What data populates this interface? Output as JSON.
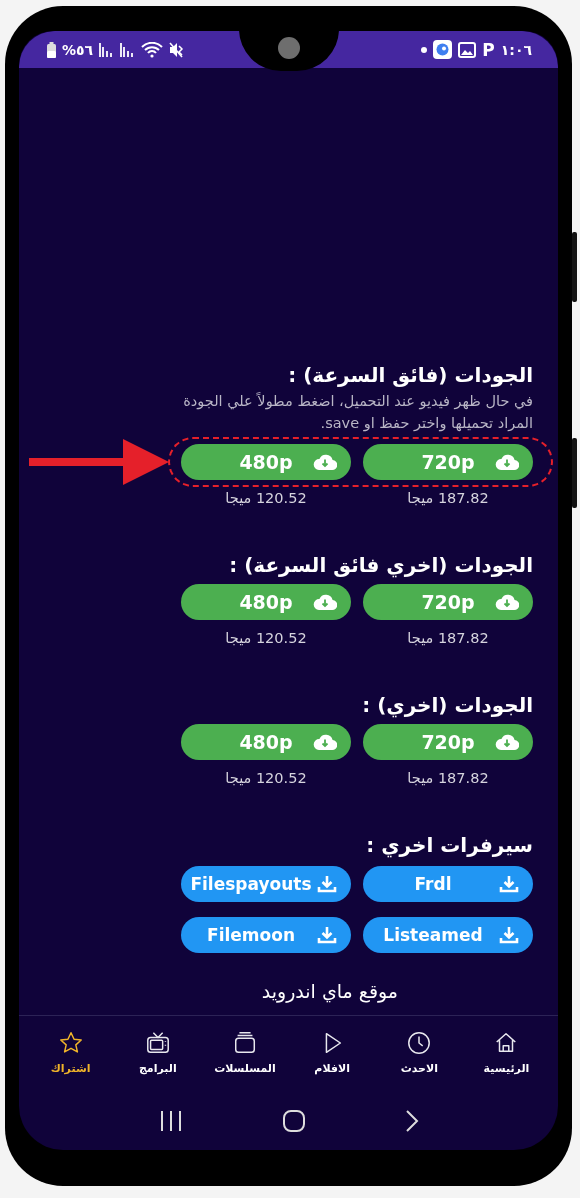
{
  "status_bar": {
    "battery": "%٥٦",
    "app_badge": "P",
    "time": "١:٠٦"
  },
  "sections": [
    {
      "title": "الجودات (فائق السرعة) :",
      "note": "في حال ظهر فيديو عند التحميل، اضغط مطولاً علي الجودة المراد تحميلها واختر حفظ او save.",
      "highlighted": true,
      "buttons": [
        {
          "label": "720p",
          "size": "187.82 ميجا"
        },
        {
          "label": "480p",
          "size": "120.52 ميجا"
        }
      ]
    },
    {
      "title": "الجودات (اخري فائق السرعة) :",
      "highlighted": false,
      "buttons": [
        {
          "label": "720p",
          "size": "187.82 ميجا"
        },
        {
          "label": "480p",
          "size": "120.52 ميجا"
        }
      ]
    },
    {
      "title": "الجودات (اخري) :",
      "highlighted": false,
      "buttons": [
        {
          "label": "720p",
          "size": "187.82 ميجا"
        },
        {
          "label": "480p",
          "size": "120.52 ميجا"
        }
      ]
    }
  ],
  "servers": {
    "title": "سيرفرات اخري :",
    "buttons": [
      "Frdl",
      "Filespayouts",
      "Listeamed",
      "Filemoon"
    ]
  },
  "footer_text": "موقع ماي اندرويد",
  "bottom_nav": [
    {
      "kind": "home",
      "label": "الرئيسية",
      "selected": false
    },
    {
      "kind": "clock",
      "label": "الاحدث",
      "selected": false
    },
    {
      "kind": "play",
      "label": "الافلام",
      "selected": false
    },
    {
      "kind": "stack",
      "label": "المسلسلات",
      "selected": false
    },
    {
      "kind": "tv",
      "label": "البرامج",
      "selected": false
    },
    {
      "kind": "star",
      "label": "اشتراك",
      "selected": true
    }
  ]
}
